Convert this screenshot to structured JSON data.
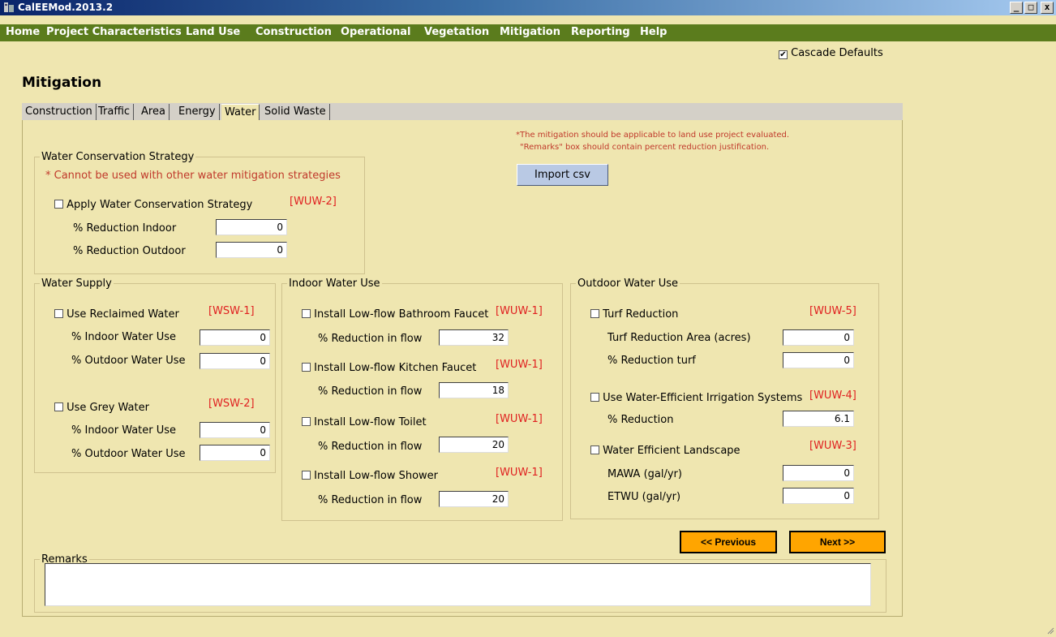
{
  "window": {
    "title": "CalEEMod.2013.2",
    "min": "_",
    "max": "□",
    "close": "x"
  },
  "menu": [
    "Home",
    "Project Characteristics",
    "Land Use",
    "Construction",
    "Operational",
    "Vegetation",
    "Mitigation",
    "Reporting",
    "Help"
  ],
  "cascade_defaults": {
    "label": "Cascade Defaults",
    "checked": true
  },
  "page_title": "Mitigation",
  "tabs": [
    "Construction",
    "Traffic",
    "Area",
    "Energy",
    "Water",
    "Solid Waste"
  ],
  "active_tab": "Water",
  "notes": {
    "line1": "*The mitigation should be applicable to land use project evaluated.",
    "line2": "\"Remarks\" box should contain percent reduction justification."
  },
  "import_button": "Import csv",
  "conservation": {
    "legend": "Water Conservation Strategy",
    "warning": "* Cannot be used with other water mitigation strategies",
    "apply_label": "Apply Water Conservation Strategy",
    "code": "[WUW-2]",
    "indoor_label": "% Reduction Indoor",
    "indoor_value": "0",
    "outdoor_label": "% Reduction Outdoor",
    "outdoor_value": "0"
  },
  "supply": {
    "legend": "Water Supply",
    "reclaimed_label": "Use Reclaimed Water",
    "reclaimed_code": "[WSW-1]",
    "reclaimed_indoor_label": "% Indoor Water Use",
    "reclaimed_indoor_value": "0",
    "reclaimed_outdoor_label": "% Outdoor Water Use",
    "reclaimed_outdoor_value": "0",
    "grey_label": "Use Grey Water",
    "grey_code": "[WSW-2]",
    "grey_indoor_label": "% Indoor Water Use",
    "grey_indoor_value": "0",
    "grey_outdoor_label": "% Outdoor Water Use",
    "grey_outdoor_value": "0"
  },
  "indoor": {
    "legend": "Indoor Water Use",
    "bath_label": "Install Low-flow Bathroom Faucet",
    "bath_code": "[WUW-1]",
    "bath_flow_label": "% Reduction in flow",
    "bath_flow_value": "32",
    "kitchen_label": "Install Low-flow Kitchen Faucet",
    "kitchen_code": "[WUW-1]",
    "kitchen_flow_label": "% Reduction in flow",
    "kitchen_flow_value": "18",
    "toilet_label": "Install Low-flow Toilet",
    "toilet_code": "[WUW-1]",
    "toilet_flow_label": "% Reduction in flow",
    "toilet_flow_value": "20",
    "shower_label": "Install Low-flow Shower",
    "shower_code": "[WUW-1]",
    "shower_flow_label": "% Reduction in flow",
    "shower_flow_value": "20"
  },
  "outdoor": {
    "legend": "Outdoor Water Use",
    "turf_label": "Turf Reduction",
    "turf_code": "[WUW-5]",
    "turf_area_label": "Turf Reduction Area (acres)",
    "turf_area_value": "0",
    "turf_pct_label": "% Reduction turf",
    "turf_pct_value": "0",
    "irrigation_label": "Use Water-Efficient Irrigation Systems",
    "irrigation_code": "[WUW-4]",
    "irrigation_pct_label": "% Reduction",
    "irrigation_pct_value": "6.1",
    "landscape_label": "Water Efficient Landscape",
    "landscape_code": "[WUW-3]",
    "mawa_label": "MAWA (gal/yr)",
    "mawa_value": "0",
    "etwu_label": "ETWU (gal/yr)",
    "etwu_value": "0"
  },
  "nav": {
    "previous": "<< Previous",
    "next": "Next >>"
  },
  "remarks": {
    "legend": "Remarks",
    "value": ""
  },
  "colors": {
    "menubar": "#5b7c1d",
    "background": "#efe6b0",
    "nav_button": "#ffa500",
    "code_red": "#e02020"
  }
}
